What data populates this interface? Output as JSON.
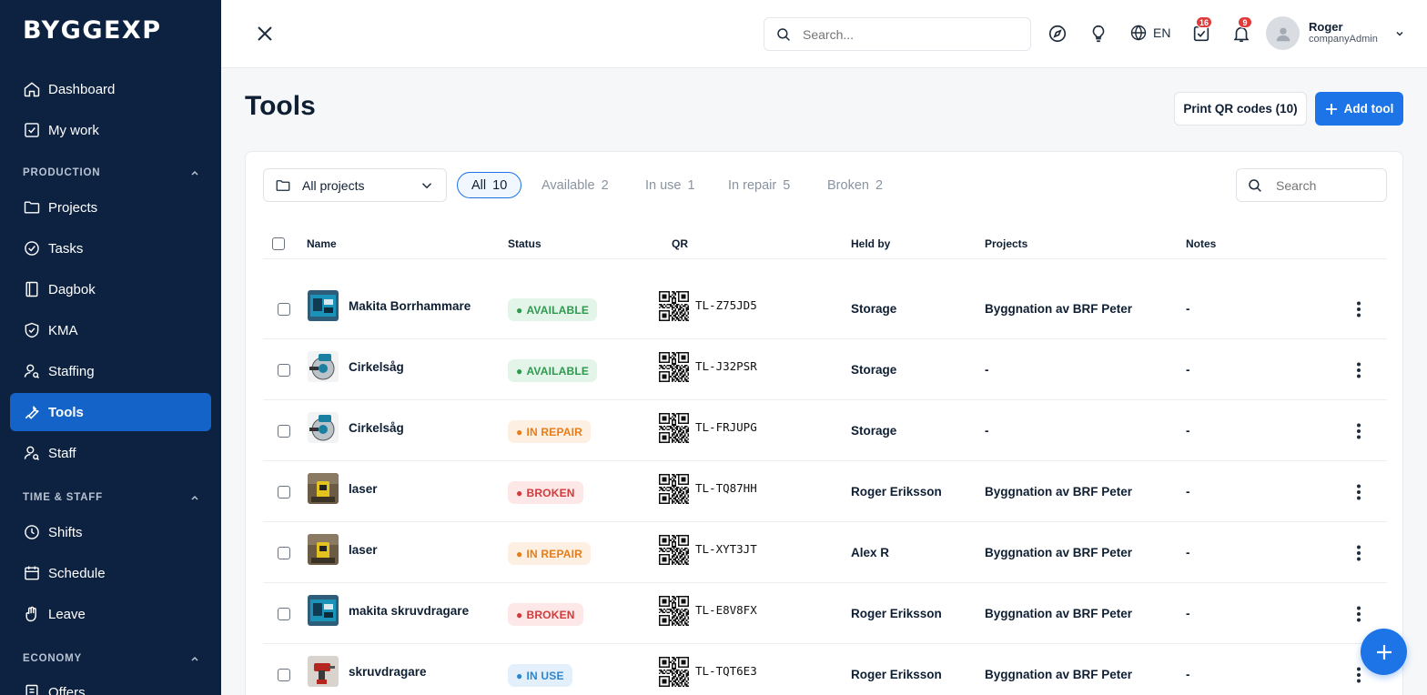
{
  "brand": "BYGGEXP",
  "sidebar": {
    "items": [
      {
        "label": "Dashboard",
        "icon": "home-icon"
      },
      {
        "label": "My work",
        "icon": "checkbox-icon"
      }
    ],
    "sections": [
      {
        "label": "PRODUCTION",
        "items": [
          {
            "label": "Projects",
            "icon": "folder-icon"
          },
          {
            "label": "Tasks",
            "icon": "check-circle-icon"
          },
          {
            "label": "Dagbok",
            "icon": "book-icon"
          },
          {
            "label": "KMA",
            "icon": "shield-icon"
          },
          {
            "label": "Staffing",
            "icon": "user-search-icon"
          },
          {
            "label": "Tools",
            "icon": "wrench-icon",
            "active": true
          },
          {
            "label": "Staff",
            "icon": "user-search-icon"
          }
        ]
      },
      {
        "label": "TIME & STAFF",
        "items": [
          {
            "label": "Shifts",
            "icon": "clock-icon"
          },
          {
            "label": "Schedule",
            "icon": "calendar-icon"
          },
          {
            "label": "Leave",
            "icon": "hand-icon"
          }
        ]
      },
      {
        "label": "ECONOMY",
        "items": [
          {
            "label": "Offers",
            "icon": "document-icon"
          }
        ]
      }
    ]
  },
  "topbar": {
    "search_placeholder": "Search...",
    "language": "EN",
    "tasks_badge": "16",
    "notifications_badge": "9",
    "user_name": "Roger",
    "user_role": "companyAdmin"
  },
  "page": {
    "title": "Tools",
    "print_button": "Print QR codes (10)",
    "add_button": "Add tool"
  },
  "filters": {
    "project_select": "All projects",
    "tabs": [
      {
        "label": "All",
        "count": "10",
        "active": true
      },
      {
        "label": "Available",
        "count": "2"
      },
      {
        "label": "In use",
        "count": "1"
      },
      {
        "label": "In repair",
        "count": "5"
      },
      {
        "label": "Broken",
        "count": "2"
      }
    ],
    "search_placeholder": "Search"
  },
  "table": {
    "columns": [
      "Name",
      "Status",
      "QR",
      "Held by",
      "Projects",
      "Notes"
    ],
    "rows": [
      {
        "name": "Makita Borrhammare",
        "status": "AVAILABLE",
        "status_kind": "available",
        "code": "TL-Z75JD5",
        "held_by": "Storage",
        "projects": "Byggnation av BRF Peter",
        "notes": "-",
        "thumb": "drill-box"
      },
      {
        "name": "Cirkelsåg",
        "status": "AVAILABLE",
        "status_kind": "available",
        "code": "TL-J32PSR",
        "held_by": "Storage",
        "projects": "-",
        "notes": "-",
        "thumb": "saw"
      },
      {
        "name": "Cirkelsåg",
        "status": "IN REPAIR",
        "status_kind": "inrepair",
        "code": "TL-FRJUPG",
        "held_by": "Storage",
        "projects": "-",
        "notes": "-",
        "thumb": "saw"
      },
      {
        "name": "laser",
        "status": "BROKEN",
        "status_kind": "broken",
        "code": "TL-TQ87HH",
        "held_by": "Roger Eriksson",
        "projects": "Byggnation av BRF Peter",
        "notes": "-",
        "thumb": "laser"
      },
      {
        "name": "laser",
        "status": "IN REPAIR",
        "status_kind": "inrepair",
        "code": "TL-XYT3JT",
        "held_by": "Alex R",
        "projects": "Byggnation av BRF Peter",
        "notes": "-",
        "thumb": "laser"
      },
      {
        "name": "makita skruvdragare",
        "status": "BROKEN",
        "status_kind": "broken",
        "code": "TL-E8V8FX",
        "held_by": "Roger Eriksson",
        "projects": "Byggnation av BRF Peter",
        "notes": "-",
        "thumb": "drill-box"
      },
      {
        "name": "skruvdragare",
        "status": "IN USE",
        "status_kind": "inuse",
        "code": "TL-TQT6E3",
        "held_by": "Roger Eriksson",
        "projects": "Byggnation av BRF Peter",
        "notes": "-",
        "thumb": "red-drill"
      }
    ]
  },
  "colors": {
    "sidebar_bg": "#0d2240",
    "active_nav": "#1463c8",
    "primary": "#1d74e6"
  }
}
